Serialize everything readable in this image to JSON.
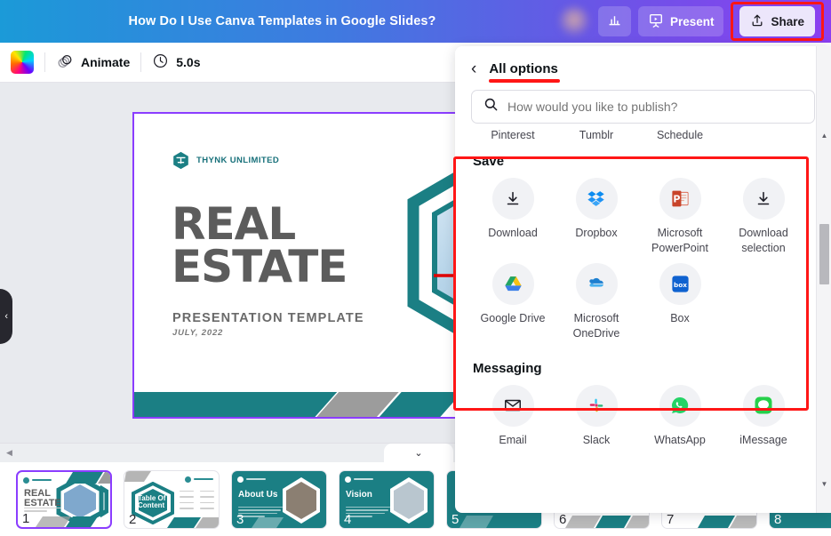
{
  "topbar": {
    "title": "How Do I Use Canva Templates in Google Slides?",
    "stats_icon": "bar-chart-icon",
    "present_label": "Present",
    "present_icon": "presentation-screen-icon",
    "share_label": "Share",
    "share_icon": "share-upload-icon",
    "avatar": "user-avatar"
  },
  "toolbar": {
    "color_swatch": "rainbow-color-swatch",
    "animate_label": "Animate",
    "animate_icon": "animate-circles-icon",
    "duration_label": "5.0s",
    "duration_icon": "clock-icon"
  },
  "slide": {
    "logo_text": "THYNK UNLIMITED",
    "title_line1": "REAL",
    "title_line2": "ESTATE",
    "subtitle": "PRESENTATION TEMPLATE",
    "date": "JULY, 2022",
    "teal": "#1b7f84",
    "selection_color": "#8b3dff"
  },
  "slide_strip": {
    "collapse_icon": "chevron-down-icon",
    "scroll_left_icon": "triangle-left-icon",
    "thumbnails": [
      {
        "number": "1",
        "title": "REAL\nESTATE",
        "style": "light",
        "selected": true
      },
      {
        "number": "2",
        "title": "Table Of\nContent",
        "style": "light",
        "selected": false
      },
      {
        "number": "3",
        "title": "About Us",
        "style": "teal",
        "selected": false
      },
      {
        "number": "4",
        "title": "Vision",
        "style": "teal",
        "selected": false
      },
      {
        "number": "5",
        "title": "",
        "style": "teal",
        "selected": false
      },
      {
        "number": "6",
        "title": "",
        "style": "light",
        "selected": false
      },
      {
        "number": "7",
        "title": "",
        "style": "light",
        "selected": false
      },
      {
        "number": "8",
        "title": "",
        "style": "teal",
        "selected": false
      }
    ]
  },
  "panel": {
    "back_icon": "back-chevron-icon",
    "title": "All options",
    "title_underline_color": "#ff1616",
    "search": {
      "icon": "search-icon",
      "placeholder": "How would you like to publish?",
      "value": ""
    },
    "partial_row": [
      "Pinterest",
      "Tumblr",
      "Schedule"
    ],
    "sections": [
      {
        "title": "Save",
        "highlighted": true,
        "tiles": [
          {
            "label": "Download",
            "icon": "download-arrow-icon"
          },
          {
            "label": "Dropbox",
            "icon": "dropbox-icon"
          },
          {
            "label": "Microsoft PowerPoint",
            "icon": "powerpoint-icon"
          },
          {
            "label": "Download selection",
            "icon": "download-arrow-icon"
          },
          {
            "label": "Google Drive",
            "icon": "google-drive-icon"
          },
          {
            "label": "Microsoft OneDrive",
            "icon": "onedrive-cloud-icon"
          },
          {
            "label": "Box",
            "icon": "box-icon"
          }
        ]
      },
      {
        "title": "Messaging",
        "highlighted": false,
        "tiles": [
          {
            "label": "Email",
            "icon": "envelope-icon"
          },
          {
            "label": "Slack",
            "icon": "slack-icon"
          },
          {
            "label": "WhatsApp",
            "icon": "whatsapp-icon"
          },
          {
            "label": "iMessage",
            "icon": "imessage-icon"
          }
        ]
      }
    ],
    "scrollbar": {
      "up_icon": "scroll-up-arrow",
      "down_icon": "scroll-down-arrow"
    }
  },
  "annotations": {
    "share_button_box_color": "#ff1616",
    "save_section_box_color": "#ff1616",
    "slide_arrow_color": "#e00000"
  }
}
